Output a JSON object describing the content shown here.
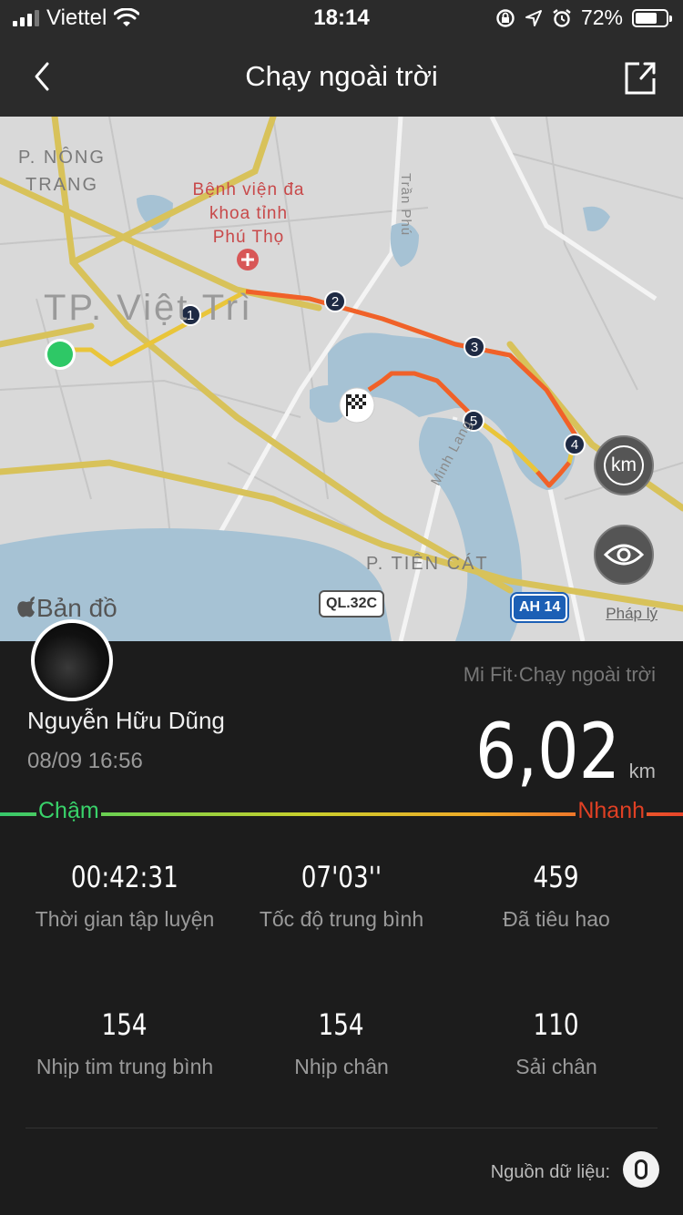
{
  "status_bar": {
    "carrier": "Viettel",
    "time": "18:14",
    "battery": "72%",
    "battery_level": 0.72,
    "icons": [
      "signal-icon",
      "wifi-icon",
      "rotation-lock-icon",
      "location-icon",
      "alarm-icon",
      "battery-icon"
    ]
  },
  "nav": {
    "title": "Chạy ngoài trời",
    "back_icon": "chevron-left-icon",
    "share_icon": "share-icon"
  },
  "map": {
    "labels": {
      "district_nong_trang_1": "P. NÔNG",
      "district_nong_trang_2": "TRANG",
      "city": "TP. Việt Trì",
      "hospital_1": "Bệnh viện đa",
      "hospital_2": "khoa tỉnh",
      "hospital_3": "Phú Thọ",
      "road_tran_phu": "Trần Phú",
      "road_minh_lang": "Minh Lang",
      "district_tien_cat": "P. TIÊN CÁT"
    },
    "road_badges": {
      "ql": "QL.32C",
      "ah": "AH 14"
    },
    "km_markers": [
      "1",
      "2",
      "3",
      "4",
      "5"
    ],
    "km_button": "km",
    "attribution": "Bản đồ",
    "legal": "Pháp lý",
    "colors": {
      "route_slow": "#e9c53a",
      "route_fast": "#f0612a",
      "water": "#a6c2d4",
      "start": "#2ec866"
    }
  },
  "activity": {
    "source_app": "Mi Fit·Chạy ngoài trời",
    "user_name": "Nguyễn Hữu Dũng",
    "date": "08/09 16:56",
    "distance": "6,02",
    "distance_unit": "km"
  },
  "pace_scale": {
    "slow": "Chậm",
    "fast": "Nhanh"
  },
  "stats": [
    {
      "value": "00:42:31",
      "label": "Thời gian tập luyện"
    },
    {
      "value": "07'03''",
      "label": "Tốc độ trung bình"
    },
    {
      "value": "459",
      "label": "Đã tiêu hao"
    },
    {
      "value": "154",
      "label": "Nhịp tim trung bình"
    },
    {
      "value": "154",
      "label": "Nhịp chân"
    },
    {
      "value": "110",
      "label": "Sải chân"
    }
  ],
  "footer": {
    "data_source": "Nguồn dữ liệu:"
  }
}
